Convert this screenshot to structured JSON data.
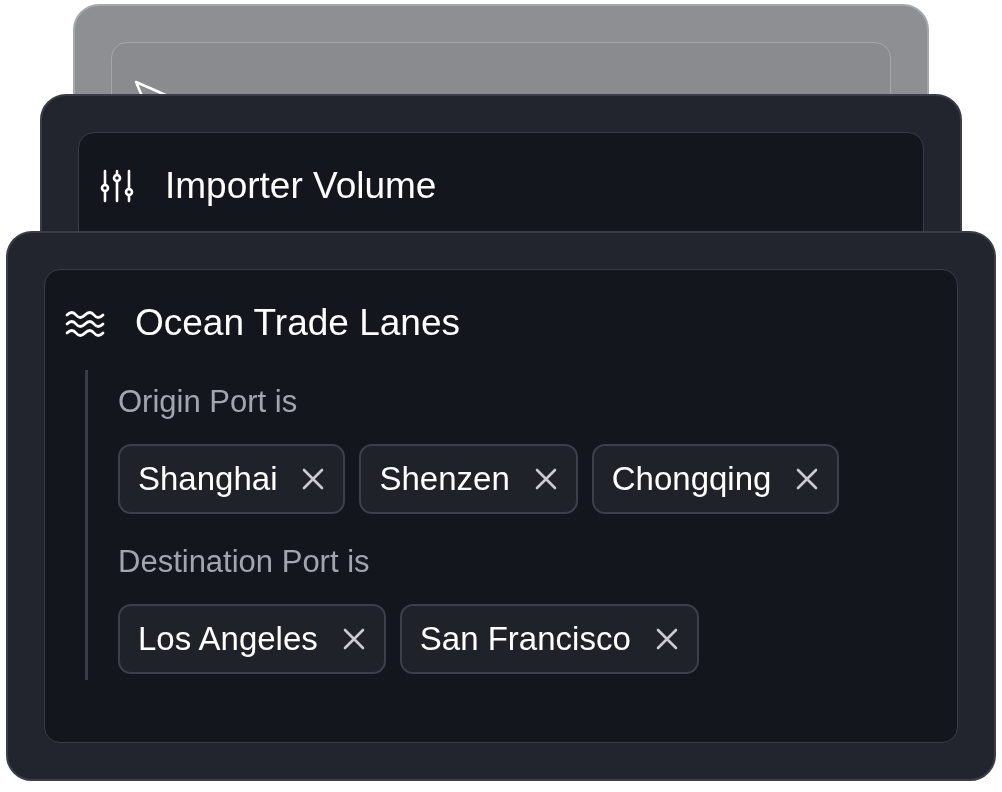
{
  "cards": [
    {
      "kind": "muted"
    },
    {
      "kind": "dark",
      "title": "Importer Volume"
    },
    {
      "kind": "dark",
      "title": "Ocean Trade Lanes",
      "filters": [
        {
          "label": "Origin Port is",
          "values": [
            "Shanghai",
            "Shenzen",
            "Chongqing"
          ]
        },
        {
          "label": "Destination Port is",
          "values": [
            "Los Angeles",
            "San Francisco"
          ]
        }
      ]
    }
  ]
}
